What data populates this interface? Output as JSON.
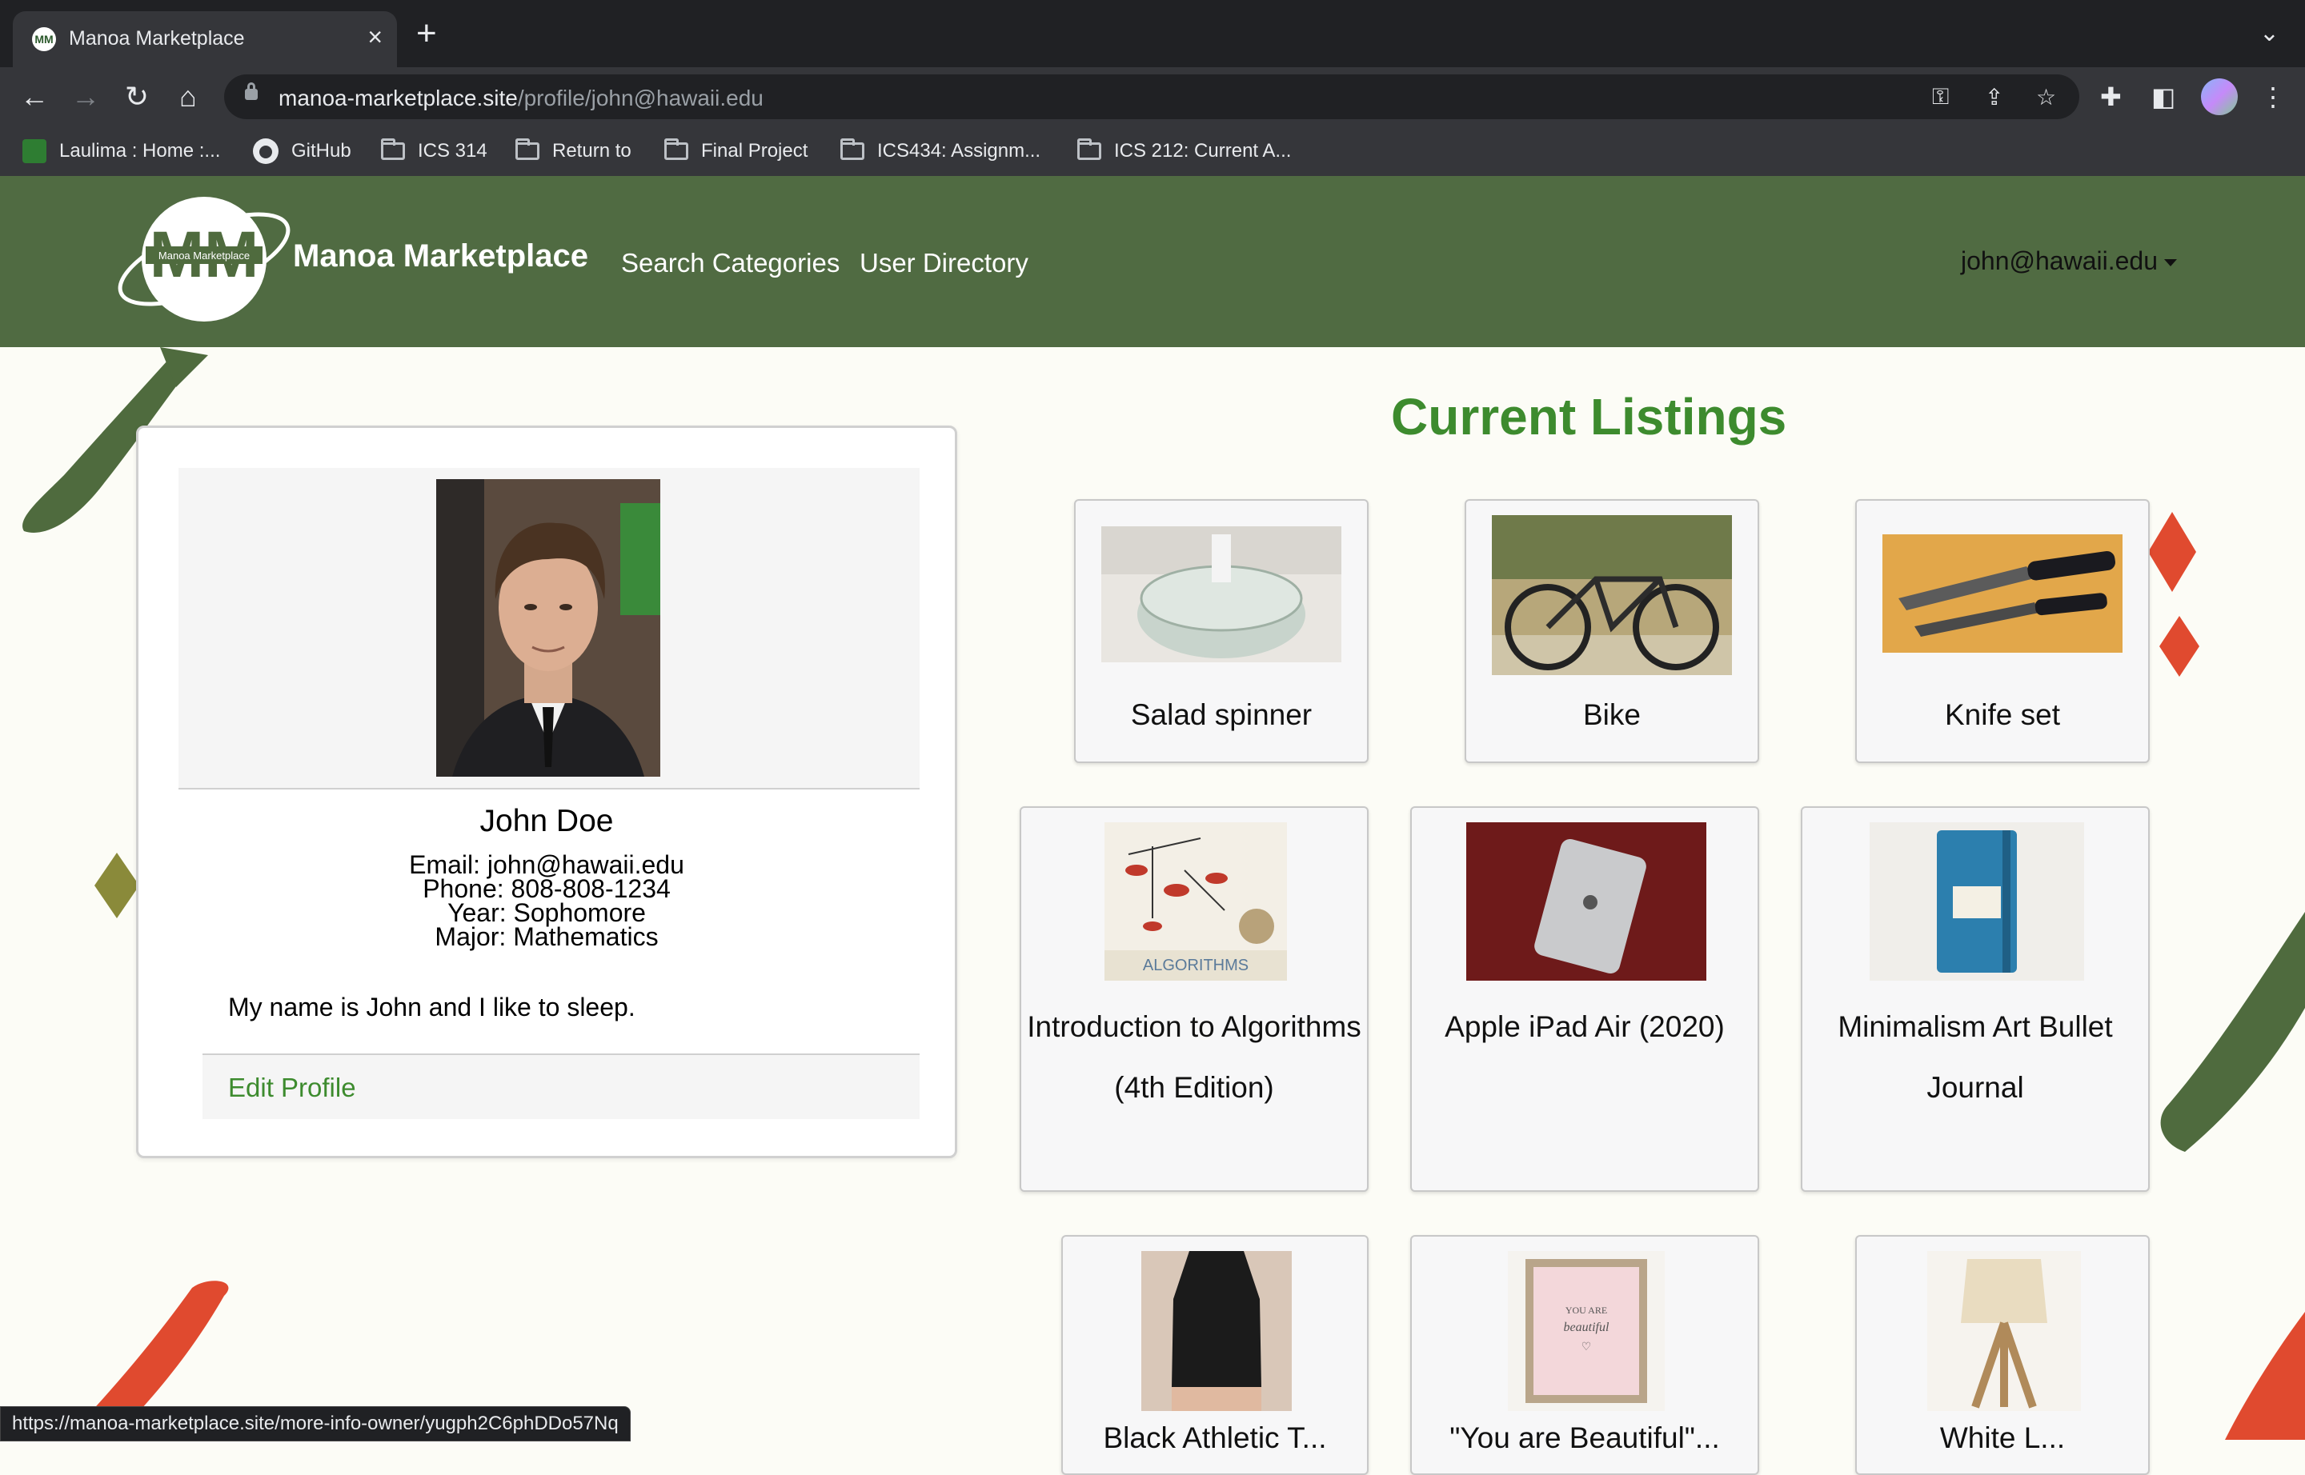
{
  "browser": {
    "tab_title": "Manoa Marketplace",
    "url_host": "manoa-marketplace.site",
    "url_path": "/profile/john@hawaii.edu",
    "bookmarks": [
      "Laulima : Home :...",
      "GitHub",
      "ICS 314",
      "Return to",
      "Final Project",
      "ICS434: Assignm...",
      "ICS 212: Current A..."
    ],
    "status_url": "https://manoa-marketplace.site/more-info-owner/yugph2C6phDDo57Nq"
  },
  "nav": {
    "logo_text": "Manoa Marketplace",
    "brand": "Manoa Marketplace",
    "links": [
      "Search Categories",
      "User Directory"
    ],
    "user": "john@hawaii.edu",
    "bg_color": "#506b42"
  },
  "profile": {
    "name": "John Doe",
    "email": "Email: john@hawaii.edu",
    "phone": "Phone: 808-808-1234",
    "year": "Year: Sophomore",
    "major": "Major: Mathematics",
    "bio": "My name is John and I like to sleep.",
    "edit_label": "Edit Profile"
  },
  "listings": {
    "title": "Current Listings",
    "items": [
      "Salad spinner",
      "Bike",
      "Knife set",
      "Introduction to Algorithms (4th Edition)",
      "Apple iPad Air (2020)",
      "Minimalism Art Bullet Journal",
      "Black Athletic T...",
      "\"You are Beautiful\"...",
      "White L..."
    ]
  },
  "colors": {
    "accent": "#3d8b2e",
    "decor_green": "#4f6b3e",
    "decor_red": "#e04a2f"
  }
}
